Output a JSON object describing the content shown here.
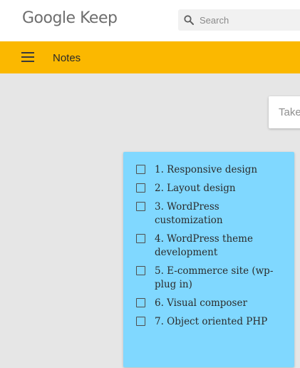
{
  "header": {
    "logo_text": "Google Keep",
    "search": {
      "placeholder": "Search",
      "icon": "search-icon"
    }
  },
  "appbar": {
    "menu_icon": "hamburger-menu-icon",
    "title": "Notes",
    "color": "#fbb800"
  },
  "composer": {
    "placeholder": "Take a note..."
  },
  "note": {
    "color": "#80d8ff",
    "items": [
      {
        "text": "1. Responsive design",
        "checked": false
      },
      {
        "text": "2. Layout design",
        "checked": false
      },
      {
        "text": "3. WordPress customization",
        "checked": false
      },
      {
        "text": "4. WordPress theme development",
        "checked": false
      },
      {
        "text": "5. E-commerce site (wp-plug in)",
        "checked": false
      },
      {
        "text": "6. Visual composer",
        "checked": false
      },
      {
        "text": "7. Object oriented PHP",
        "checked": false
      }
    ]
  }
}
